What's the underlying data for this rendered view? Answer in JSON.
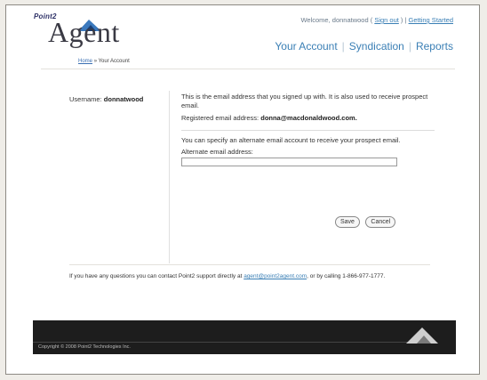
{
  "brand": {
    "point2": "Point2",
    "agent": "Agent"
  },
  "breadcrumb": {
    "home": "Home",
    "separator": "»",
    "current": "Your Account"
  },
  "header": {
    "welcome_prefix": "Welcome, donnatwood ( ",
    "sign_out": "Sign out",
    "welcome_mid": " ) | ",
    "getting_started": "Getting Started"
  },
  "nav": {
    "items": [
      "Your Account",
      "Syndication",
      "Reports"
    ]
  },
  "account": {
    "username_label": "Username:",
    "username_value": "donnatwood",
    "email_note": "This is the email address that you signed up with. It is also used to receive prospect email.",
    "registered_label": "Registered email address:",
    "registered_value": "donna@macdonaldwood.com",
    "registered_suffix": ".",
    "alternate_note": "You can specify an alternate email account to receive your prospect email.",
    "alternate_label": "Alternate email address:",
    "alternate_value": ""
  },
  "buttons": {
    "save": "Save",
    "cancel": "Cancel"
  },
  "support": {
    "prefix": "If you have any questions you can contact Point2 support directly at ",
    "email": "agent@point2agent.com",
    "suffix": ", or by calling 1-866-977-1777."
  },
  "footer": {
    "copyright": "Copyright © 2008 Point2 Technologies Inc."
  },
  "colors": {
    "link": "#3a7fb5",
    "footer_bg": "#1d1d1d",
    "page_bg": "#efede8"
  }
}
